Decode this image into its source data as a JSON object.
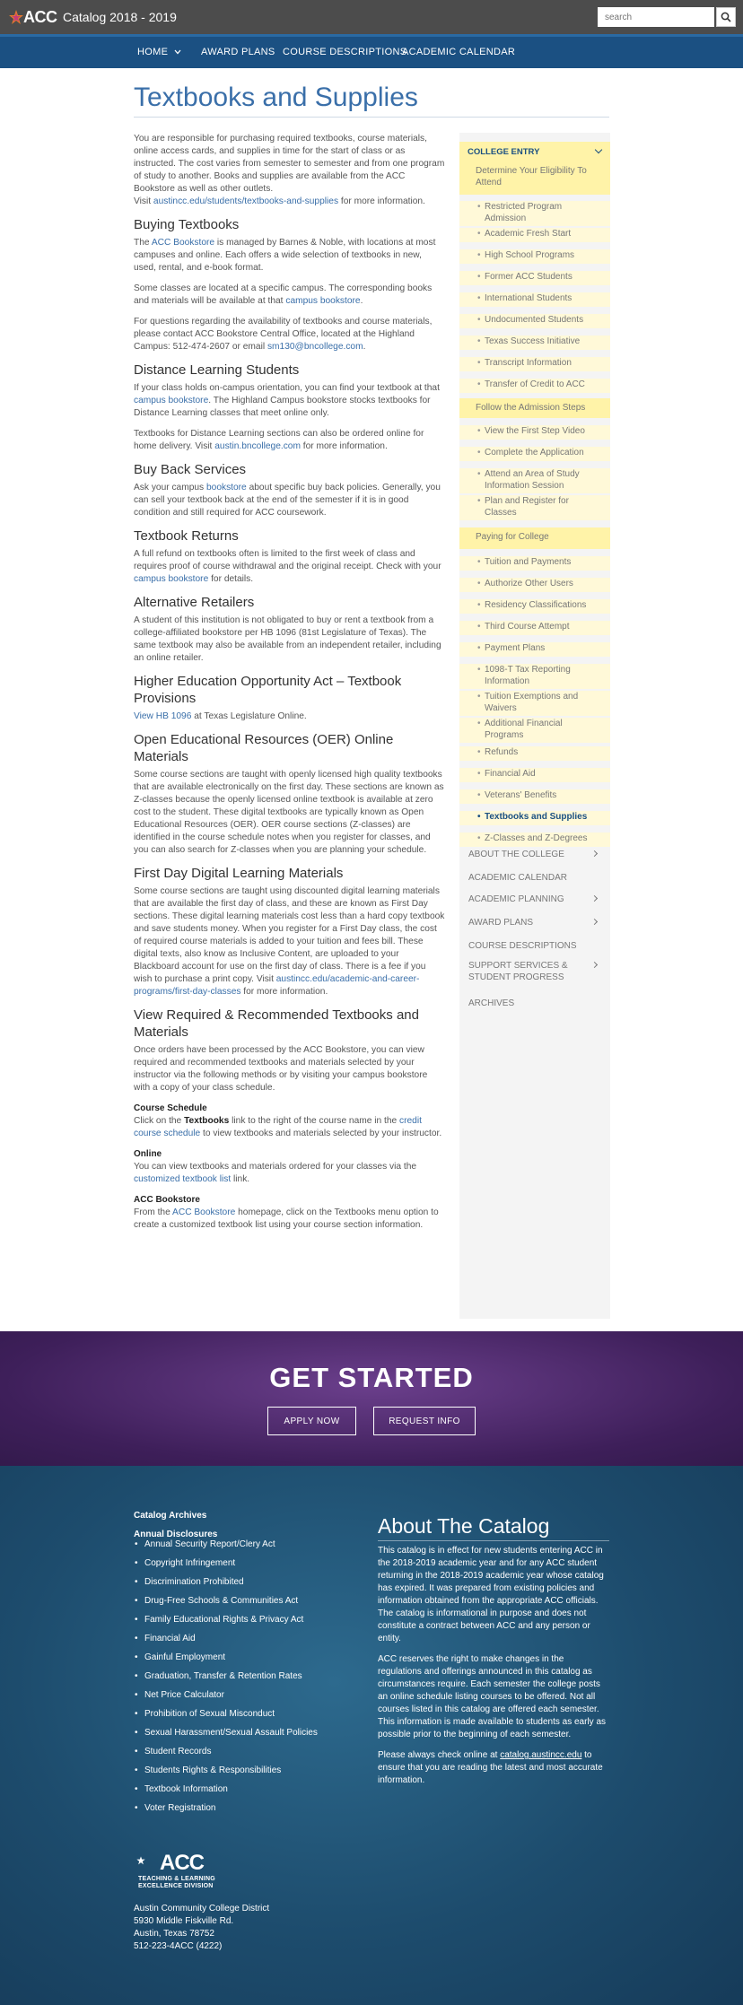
{
  "header": {
    "logo_text": "ACC",
    "site_title": "Catalog 2018 - 2019",
    "search_placeholder": "search"
  },
  "nav": [
    {
      "label": "HOME"
    },
    {
      "label": "AWARD PLANS"
    },
    {
      "label": "COURSE DESCRIPTIONS"
    },
    {
      "label": "ACADEMIC CALENDAR"
    }
  ],
  "page": {
    "title": "Textbooks and Supplies",
    "intro": "You are responsible for purchasing required textbooks, course materials, online access cards, and supplies in time for the start of class or as instructed. The cost varies from semester to semester and from one program of study to another. Books and supplies are available from the ACC Bookstore as well as other outlets.",
    "intro_visit": "Visit",
    "intro_link": "austincc.edu/students/textbooks-and-supplies",
    "intro_after": "for more information.",
    "buying": {
      "heading": "Buying Textbooks",
      "p1_a": "The",
      "p1_link": "ACC Bookstore",
      "p1_b": "is managed by Barnes & Noble, with locations at most campuses and online. Each offers a wide selection of textbooks in new, used, rental, and e-book format.",
      "p2_a": "Some classes are located at a specific campus. The corresponding books and materials will be available at that",
      "p2_link": "campus bookstore",
      "p2_b": ".",
      "p3_a": "For questions regarding the availability of textbooks and course materials, please contact ACC Bookstore Central Office, located at the Highland Campus: 512-474-2607 or email",
      "p3_link": "sm130@bncollege.com",
      "p3_b": "."
    },
    "distance": {
      "heading": "Distance Learning Students",
      "p1_a": "If your class holds on-campus orientation, you can find your textbook at that",
      "p1_link": "campus bookstore",
      "p1_b": ". The Highland Campus bookstore stocks textbooks for Distance Learning classes that meet online only.",
      "p2_a": "Textbooks for Distance Learning sections can also be ordered online for home delivery. Visit",
      "p2_link": "austin.bncollege.com",
      "p2_b": "for more information."
    },
    "buyback": {
      "heading": "Buy Back Services",
      "p1_a": "Ask your campus",
      "p1_link": "bookstore",
      "p1_b": "about specific buy back policies. Generally, you can sell your textbook back at the end of the semester if it is in good condition and still required for ACC coursework."
    },
    "returns": {
      "heading": "Textbook Returns",
      "p1_a": "A full refund on textbooks often is limited to the first week of class and requires proof of course withdrawal and the original receipt. Check with your",
      "p1_link": "campus bookstore",
      "p1_b": "for details."
    },
    "alt": {
      "heading": "Alternative Retailers",
      "p1": "A student of this institution is not obligated to buy or rent a textbook from a college-affiliated bookstore per HB 1096 (81st Legislature of Texas). The same textbook may also be available from an independent retailer, including an online retailer."
    },
    "heoa": {
      "heading": "Higher Education Opportunity Act – Textbook Provisions",
      "link": "View HB 1096",
      "after": "at Texas Legislature Online."
    },
    "oer": {
      "heading": "Open Educational Resources (OER) Online Materials",
      "p1": "Some course sections are taught with openly licensed high quality textbooks that are available electronically on the first day. These sections are known as Z-classes because the openly licensed online textbook is available at zero cost to the student. These digital textbooks are typically known as Open Educational Resources (OER). OER course sections (Z-classes) are identified in the course schedule notes when you register for classes, and you can also search for Z-classes when you are planning your schedule."
    },
    "firstday": {
      "heading": "First Day Digital Learning Materials",
      "p1_a": "Some course sections are taught using discounted digital learning materials that are available the first day of class, and these are known as First Day sections. These digital learning materials cost less than a hard copy textbook and save students money. When you register for a First Day class, the cost of required course materials is added to your tuition and fees bill. These digital texts, also know as Inclusive Content, are uploaded to your Blackboard account for use on the first day of class. There is a fee if you wish to purchase a print copy. Visit",
      "p1_link": "austincc.edu/academic-and-career-programs/first-day-classes",
      "p1_b": "for more information."
    },
    "view": {
      "heading": "View Required & Recommended Textbooks and Materials",
      "p1": "Once orders have been processed by the ACC Bookstore, you can view required and recommended textbooks and materials selected by your instructor via the following methods or by visiting your campus bookstore with a copy of your class schedule.",
      "sched_h": "Course Schedule",
      "sched_a": "Click on the",
      "sched_bold": "Textbooks",
      "sched_b": "link to the right of the course name in the",
      "sched_link": "credit course schedule",
      "sched_c": "to view textbooks and materials selected by your instructor.",
      "online_h": "Online",
      "online_a": "You can view textbooks and materials ordered for your classes via the",
      "online_link": "customized textbook list",
      "online_b": "link.",
      "store_h": "ACC Bookstore",
      "store_a": "From the",
      "store_link": "ACC Bookstore",
      "store_b": "homepage, click on the Textbooks menu option to create a customized textbook list using your course section information."
    }
  },
  "sidebar": {
    "heading": "COLLEGE ENTRY",
    "groups": [
      {
        "label": "Determine Your Eligibility To Attend",
        "items": [
          "Restricted Program Admission",
          "Academic Fresh Start",
          "High School Programs",
          "Former ACC Students",
          "International Students",
          "Undocumented Students",
          "Texas Success Initiative",
          "Transcript Information",
          "Transfer of Credit to ACC"
        ]
      },
      {
        "label": "Follow the Admission Steps",
        "items": [
          "View the First Step Video",
          "Complete the Application",
          "Attend an Area of Study Information Session",
          "Plan and Register for Classes"
        ]
      },
      {
        "label": "Paying for College",
        "items": [
          "Tuition and Payments",
          "Authorize Other Users",
          "Residency Classifications",
          "Third Course Attempt",
          "Payment Plans",
          "1098-T Tax Reporting Information",
          "Tuition Exemptions and Waivers",
          "Additional Financial Programs",
          "Refunds",
          "Financial Aid",
          "Veterans' Benefits",
          "Textbooks and Supplies",
          "Z-Classes and Z-Degrees"
        ]
      }
    ],
    "current": "Textbooks and Supplies",
    "top_items": [
      "ABOUT THE COLLEGE",
      "ACADEMIC CALENDAR",
      "ACADEMIC PLANNING",
      "AWARD PLANS",
      "COURSE DESCRIPTIONS",
      "SUPPORT SERVICES & STUDENT PROGRESS",
      "ARCHIVES"
    ]
  },
  "cta": {
    "title": "GET STARTED",
    "apply": "APPLY NOW",
    "request": "REQUEST INFO"
  },
  "footer": {
    "archives": "Catalog Archives",
    "disclosures": "Annual Disclosures",
    "links": [
      "Annual Security Report/Clery Act",
      "Copyright Infringement",
      "Discrimination Prohibited",
      "Drug-Free Schools & Communities Act",
      "Family Educational Rights & Privacy Act",
      "Financial Aid",
      "Gainful Employment",
      "Graduation, Transfer & Retention Rates",
      "Net Price Calculator",
      "Prohibition of Sexual Misconduct",
      "Sexual Harassment/Sexual Assault Policies",
      "Student Records",
      "Students Rights & Responsibilities",
      "Textbook Information",
      "Voter Registration"
    ],
    "about_title": "About The Catalog",
    "about_p1": "This catalog is in effect for new students entering ACC in the 2018-2019 academic year and for any ACC student returning in the 2018-2019 academic year whose catalog has expired. It was prepared from existing policies and information obtained from the appropriate ACC officials. The catalog is informational in purpose and does not constitute a contract between ACC and any person or entity.",
    "about_p2": "ACC reserves the right to make changes in the regulations and offerings announced in this catalog as circumstances require. Each semester the college posts an online schedule listing courses to be offered. Not all courses listed in this catalog are offered each semester. This information is made available to students as early as possible prior to the beginning of each semester.",
    "about_p3_a": "Please always check online at",
    "about_p3_link": "catalog.austincc.edu",
    "about_p3_b": "to ensure that you are reading the latest and most accurate information.",
    "logo_text": "ACC",
    "logo_sub1": "TEACHING & LEARNING",
    "logo_sub2": "EXCELLENCE DIVISION",
    "addr1": "Austin Community College District",
    "addr2": "5930 Middle Fiskville Rd.",
    "addr3": "Austin, Texas 78752",
    "addr4": "512-223-4ACC (4222)"
  }
}
